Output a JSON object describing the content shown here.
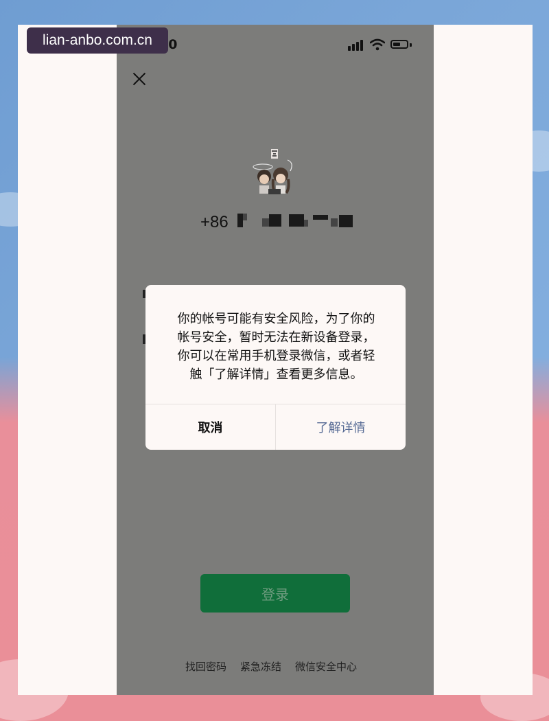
{
  "watermark": "lian-anbo.com.cn",
  "status_bar": {
    "time": "50",
    "icons": [
      "signal-icon",
      "wifi-icon",
      "battery-icon"
    ]
  },
  "login": {
    "close_icon": "close-icon",
    "avatar": "avatar",
    "phone_prefix": "+86",
    "login_button": "登录",
    "links": [
      "找回密码",
      "紧急冻结",
      "微信安全中心"
    ]
  },
  "dialog": {
    "message_lines": [
      "你的帐号可能有安全风险，为了你的",
      "帐号安全，暂时无法在新设备登录，",
      "你可以在常用手机登录微信，或者轻",
      "触「了解详情」查看更多信息。"
    ],
    "cancel": "取消",
    "details": "了解详情"
  },
  "colors": {
    "overlay": "#7c7c7a",
    "login_button": "#106e3a",
    "details_text": "#576b95",
    "frame": "#fdf8f6"
  }
}
